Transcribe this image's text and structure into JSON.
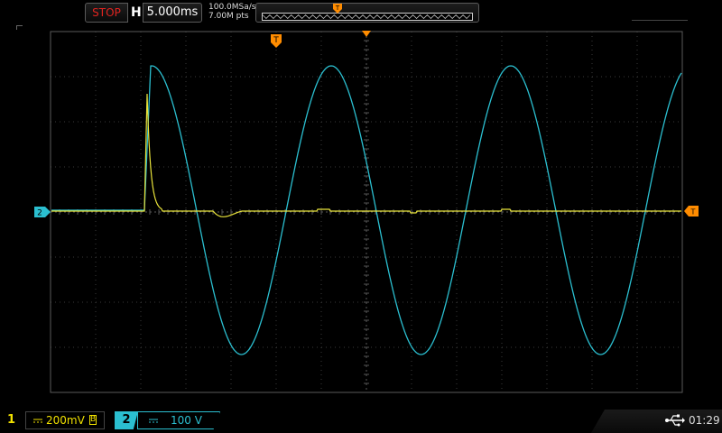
{
  "topbar": {
    "run_state": "STOP",
    "horizontal_label": "H",
    "timebase": "5.000ms",
    "sample_rate": "100.0MSa/s",
    "memory_depth": "7.00M pts",
    "trigger_marker": "T"
  },
  "markers": {
    "trigger_position": "T",
    "trigger_level": "T",
    "ch2_ground": "2"
  },
  "bottombar": {
    "ch1": {
      "number": "1",
      "scale": "200mV",
      "bw_flag": "B",
      "color": "#f0e000"
    },
    "ch2": {
      "number": "2",
      "scale": "100 V",
      "color": "#2bbfd0"
    },
    "clock": "01:29",
    "usb_icon": "usb-icon"
  },
  "colors": {
    "ch1": "#e8e23a",
    "ch2": "#2bbfd0",
    "trigger": "#ff8c00",
    "stop": "#e0231f"
  }
}
